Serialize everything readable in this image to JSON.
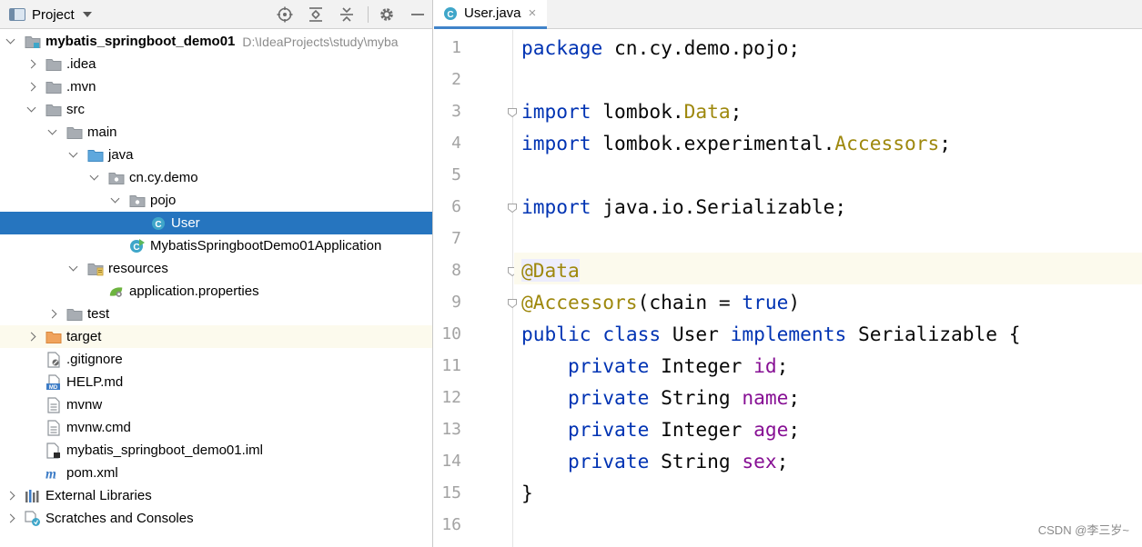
{
  "project_panel": {
    "title": "Project",
    "tree": [
      {
        "label": "mybatis_springboot_demo01",
        "path": "D:\\IdeaProjects\\study\\myba",
        "bold": true,
        "depth": 0,
        "arrow": "down",
        "icon": "module-folder-icon"
      },
      {
        "label": ".idea",
        "depth": 1,
        "arrow": "right",
        "icon": "folder-icon"
      },
      {
        "label": ".mvn",
        "depth": 1,
        "arrow": "right",
        "icon": "folder-icon"
      },
      {
        "label": "src",
        "depth": 1,
        "arrow": "down",
        "icon": "folder-icon"
      },
      {
        "label": "main",
        "depth": 2,
        "arrow": "down",
        "icon": "folder-icon"
      },
      {
        "label": "java",
        "depth": 3,
        "arrow": "down",
        "icon": "source-folder-icon"
      },
      {
        "label": "cn.cy.demo",
        "depth": 4,
        "arrow": "down",
        "icon": "package-icon"
      },
      {
        "label": "pojo",
        "depth": 5,
        "arrow": "down",
        "icon": "package-icon"
      },
      {
        "label": "User",
        "depth": 6,
        "arrow": "none",
        "icon": "class-icon",
        "selected": true
      },
      {
        "label": "MybatisSpringbootDemo01Application",
        "depth": 5,
        "arrow": "none",
        "icon": "spring-boot-class-icon"
      },
      {
        "label": "resources",
        "depth": 3,
        "arrow": "down",
        "icon": "resources-folder-icon"
      },
      {
        "label": "application.properties",
        "depth": 4,
        "arrow": "none",
        "icon": "spring-properties-icon"
      },
      {
        "label": "test",
        "depth": 2,
        "arrow": "right",
        "icon": "folder-icon"
      },
      {
        "label": "target",
        "depth": 1,
        "arrow": "right",
        "icon": "excluded-folder-icon",
        "highlight": true
      },
      {
        "label": ".gitignore",
        "depth": 1,
        "arrow": "none",
        "icon": "ignore-file-icon"
      },
      {
        "label": "HELP.md",
        "depth": 1,
        "arrow": "none",
        "icon": "markdown-file-icon"
      },
      {
        "label": "mvnw",
        "depth": 1,
        "arrow": "none",
        "icon": "text-file-icon"
      },
      {
        "label": "mvnw.cmd",
        "depth": 1,
        "arrow": "none",
        "icon": "text-file-icon"
      },
      {
        "label": "mybatis_springboot_demo01.iml",
        "depth": 1,
        "arrow": "none",
        "icon": "iml-file-icon"
      },
      {
        "label": "pom.xml",
        "depth": 1,
        "arrow": "none",
        "icon": "maven-pom-icon"
      },
      {
        "label": "External Libraries",
        "depth": 0,
        "arrow": "right",
        "icon": "libraries-icon"
      },
      {
        "label": "Scratches and Consoles",
        "depth": 0,
        "arrow": "right",
        "icon": "scratches-icon"
      }
    ]
  },
  "editor": {
    "tab": {
      "label": "User.java",
      "close": "×"
    },
    "lines": [
      {
        "n": "1",
        "tokens": [
          {
            "t": "package",
            "c": "kw"
          },
          {
            "t": " cn.cy.demo.pojo;"
          }
        ]
      },
      {
        "n": "2",
        "tokens": []
      },
      {
        "n": "3",
        "fold": true,
        "tokens": [
          {
            "t": "import",
            "c": "kw"
          },
          {
            "t": " lombok."
          },
          {
            "t": "Data",
            "c": "ann"
          },
          {
            "t": ";"
          }
        ]
      },
      {
        "n": "4",
        "tokens": [
          {
            "t": "import",
            "c": "kw"
          },
          {
            "t": " lombok.experimental."
          },
          {
            "t": "Accessors",
            "c": "ann"
          },
          {
            "t": ";"
          }
        ]
      },
      {
        "n": "5",
        "tokens": []
      },
      {
        "n": "6",
        "fold": true,
        "tokens": [
          {
            "t": "import",
            "c": "kw"
          },
          {
            "t": " java.io.Serializable;"
          }
        ]
      },
      {
        "n": "7",
        "tokens": []
      },
      {
        "n": "8",
        "fold": true,
        "caret": true,
        "tokens": [
          {
            "t": "@Data",
            "c": "ann ann-hl"
          }
        ]
      },
      {
        "n": "9",
        "fold": true,
        "tokens": [
          {
            "t": "@Accessors",
            "c": "ann"
          },
          {
            "t": "(chain = "
          },
          {
            "t": "true",
            "c": "kw"
          },
          {
            "t": ")"
          }
        ]
      },
      {
        "n": "10",
        "tokens": [
          {
            "t": "public",
            "c": "kw"
          },
          {
            "t": " "
          },
          {
            "t": "class",
            "c": "kw"
          },
          {
            "t": " User "
          },
          {
            "t": "implements",
            "c": "kw"
          },
          {
            "t": " Serializable {"
          }
        ]
      },
      {
        "n": "11",
        "tokens": [
          {
            "t": "    "
          },
          {
            "t": "private",
            "c": "kw"
          },
          {
            "t": " Integer "
          },
          {
            "t": "id",
            "c": "fld"
          },
          {
            "t": ";"
          }
        ]
      },
      {
        "n": "12",
        "tokens": [
          {
            "t": "    "
          },
          {
            "t": "private",
            "c": "kw"
          },
          {
            "t": " String "
          },
          {
            "t": "name",
            "c": "fld"
          },
          {
            "t": ";"
          }
        ]
      },
      {
        "n": "13",
        "tokens": [
          {
            "t": "    "
          },
          {
            "t": "private",
            "c": "kw"
          },
          {
            "t": " Integer "
          },
          {
            "t": "age",
            "c": "fld"
          },
          {
            "t": ";"
          }
        ]
      },
      {
        "n": "14",
        "tokens": [
          {
            "t": "    "
          },
          {
            "t": "private",
            "c": "kw"
          },
          {
            "t": " String "
          },
          {
            "t": "sex",
            "c": "fld"
          },
          {
            "t": ";"
          }
        ]
      },
      {
        "n": "15",
        "tokens": [
          {
            "t": "}"
          }
        ]
      },
      {
        "n": "16",
        "tokens": []
      }
    ]
  },
  "watermark": "CSDN @李三岁~"
}
